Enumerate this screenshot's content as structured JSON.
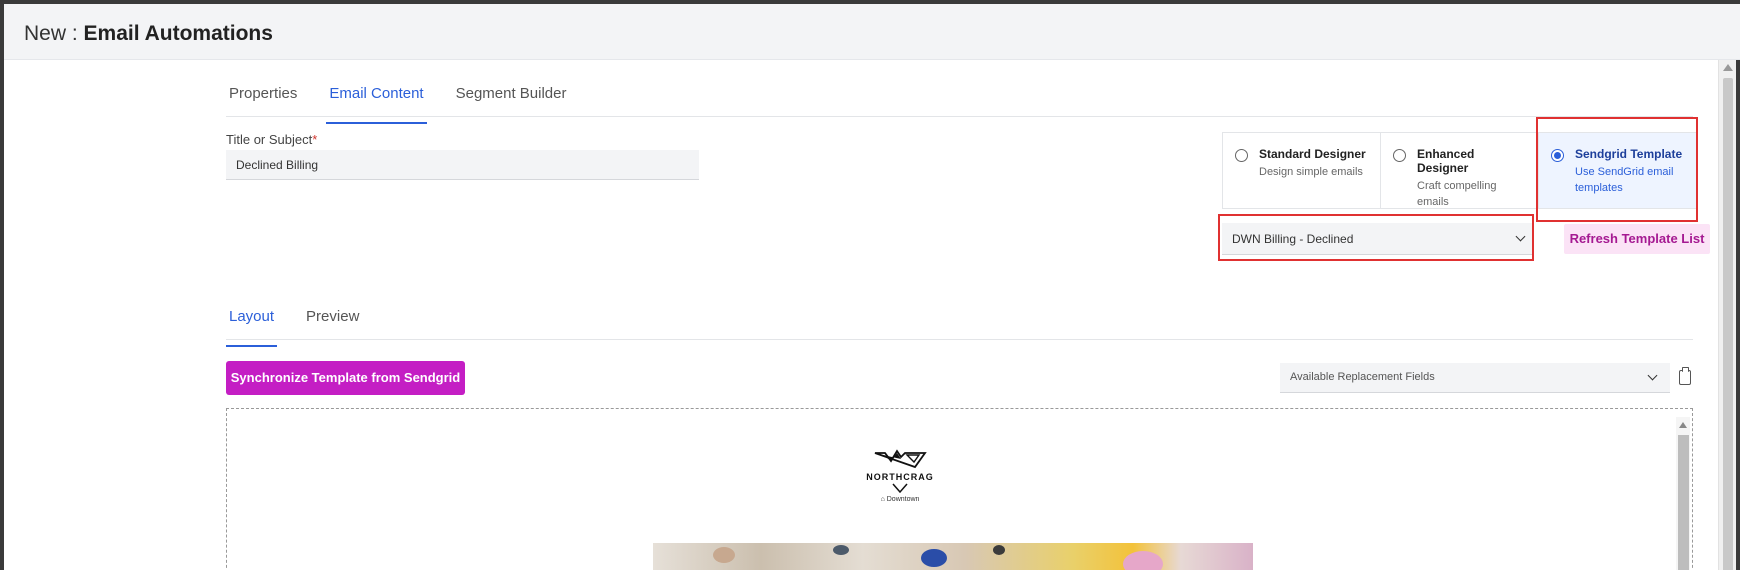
{
  "header": {
    "prefix": "New : ",
    "title": "Email Automations"
  },
  "tabs": [
    {
      "label": "Properties",
      "active": false
    },
    {
      "label": "Email Content",
      "active": true
    },
    {
      "label": "Segment Builder",
      "active": false
    }
  ],
  "form": {
    "subject_label": "Title or Subject",
    "required_marker": "*",
    "subject_value": "Declined Billing"
  },
  "designers": [
    {
      "title": "Standard Designer",
      "desc": "Design simple emails",
      "selected": false
    },
    {
      "title": "Enhanced Designer",
      "desc": "Craft compelling emails",
      "selected": false
    },
    {
      "title": "Sendgrid Template",
      "desc": "Use SendGrid email templates",
      "selected": true
    }
  ],
  "template": {
    "selected": "DWN Billing - Declined",
    "refresh_label": "Refresh Template List"
  },
  "content_tabs": [
    {
      "label": "Layout",
      "active": true
    },
    {
      "label": "Preview",
      "active": false
    }
  ],
  "toolbar": {
    "sync_label": "Synchronize Template from Sendgrid",
    "fields_placeholder": "Available Replacement Fields"
  },
  "email_preview": {
    "brand": "NORTHCRAG",
    "location": "Downtown"
  },
  "colors": {
    "accent_blue": "#2b5fd9",
    "magenta_button": "#c41ec4",
    "refresh_button_bg": "#fbe3f6",
    "highlight_red": "#e03131"
  },
  "icons": [
    "chevron-down-icon",
    "clipboard-icon",
    "home-icon"
  ]
}
